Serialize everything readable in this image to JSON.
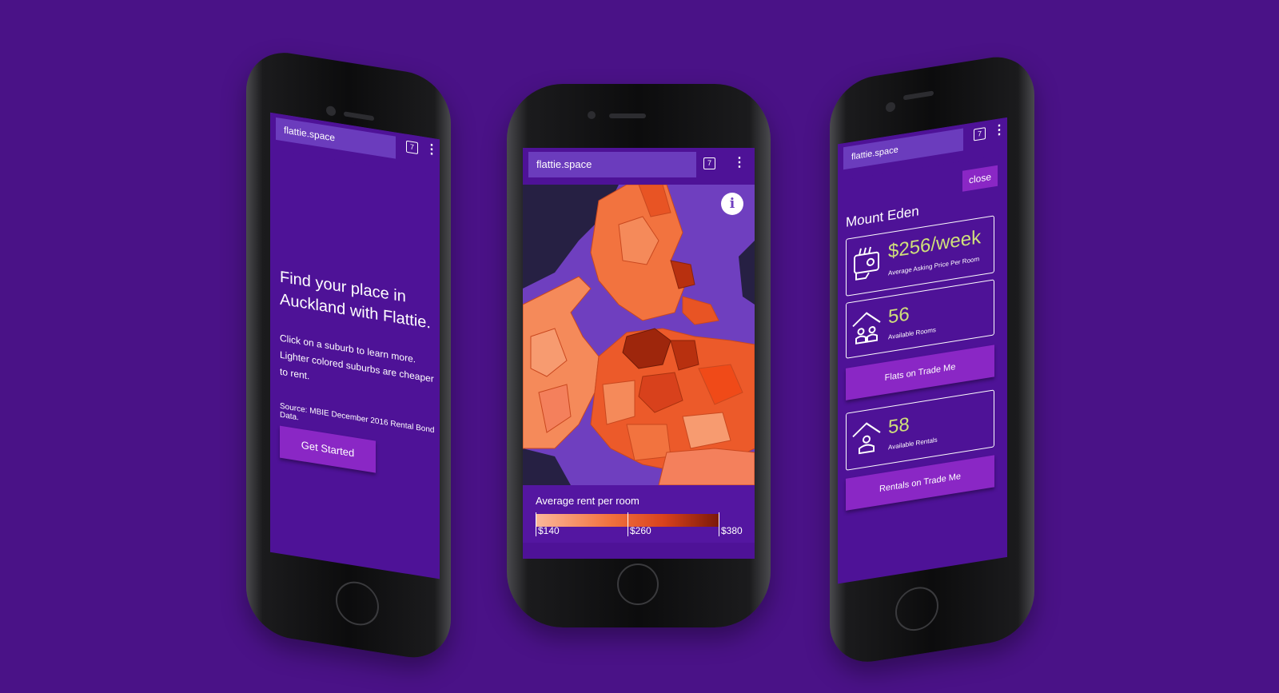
{
  "colors": {
    "background": "#4a1287",
    "screen": "#4e1297",
    "url_field": "#6b3cbd",
    "water": "#6f3fbf",
    "button": "#8a27c5",
    "stat_value": "#cfe07a"
  },
  "left_phone": {
    "url": "flattie.space",
    "tab_count": "7",
    "menu_icon": "more-vert-icon",
    "hero_title": "Find your place in Auckland with Flattie.",
    "hero_body": "Click on a suburb to learn more. Lighter colored suburbs are cheaper to rent.",
    "source": "Source: MBIE December 2016 Rental Bond Data.",
    "cta_label": "Get Started"
  },
  "center_phone": {
    "url": "flattie.space",
    "tab_count": "7",
    "menu_icon": "more-vert-icon",
    "info_icon": "i",
    "legend": {
      "title": "Average rent per room",
      "min_label": "$140",
      "mid_label": "$260",
      "max_label": "$380",
      "scale": {
        "min": 140,
        "mid": 260,
        "max": 380
      }
    }
  },
  "right_phone": {
    "url": "flattie.space",
    "tab_count": "7",
    "menu_icon": "more-vert-icon",
    "close_label": "close",
    "suburb": "Mount Eden",
    "price": {
      "value": "$256/week",
      "caption": "Average Asking Price Per Room",
      "icon": "wallet-hand-icon"
    },
    "rooms": {
      "value": "56",
      "caption": "Available Rooms",
      "icon": "house-people-icon"
    },
    "flats_cta": "Flats on Trade Me",
    "rentals": {
      "value": "58",
      "caption": "Available Rentals",
      "icon": "house-person-icon"
    },
    "rentals_cta": "Rentals on Trade Me"
  }
}
